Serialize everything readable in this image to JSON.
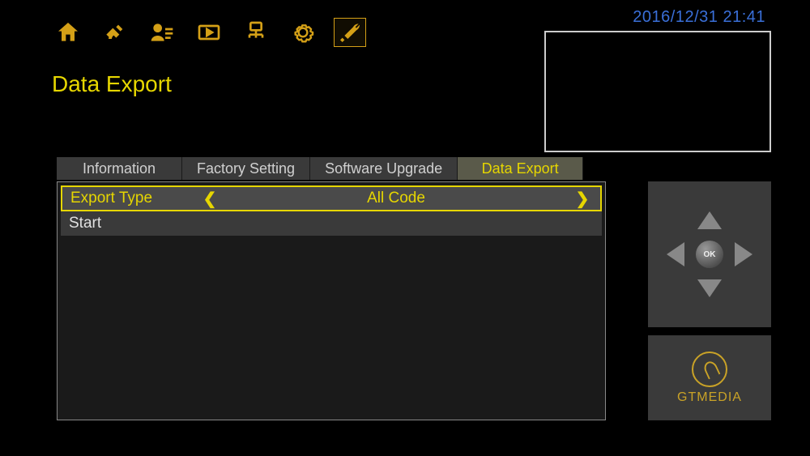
{
  "datetime": "2016/12/31  21:41",
  "page_title": "Data Export",
  "toolbar_icons": [
    {
      "name": "home-icon"
    },
    {
      "name": "satellite-icon"
    },
    {
      "name": "user-list-icon"
    },
    {
      "name": "media-icon"
    },
    {
      "name": "network-icon"
    },
    {
      "name": "settings-icon"
    },
    {
      "name": "tools-icon",
      "active": true
    }
  ],
  "tabs": [
    {
      "label": "Information",
      "active": false
    },
    {
      "label": "Factory Setting",
      "active": false
    },
    {
      "label": "Software Upgrade",
      "active": false
    },
    {
      "label": "Data Export",
      "active": true
    }
  ],
  "rows": {
    "export_type": {
      "label": "Export Type",
      "value": "All Code"
    },
    "start": {
      "label": "Start"
    }
  },
  "dpad_ok": "OK",
  "brand": "GTMEDIA"
}
